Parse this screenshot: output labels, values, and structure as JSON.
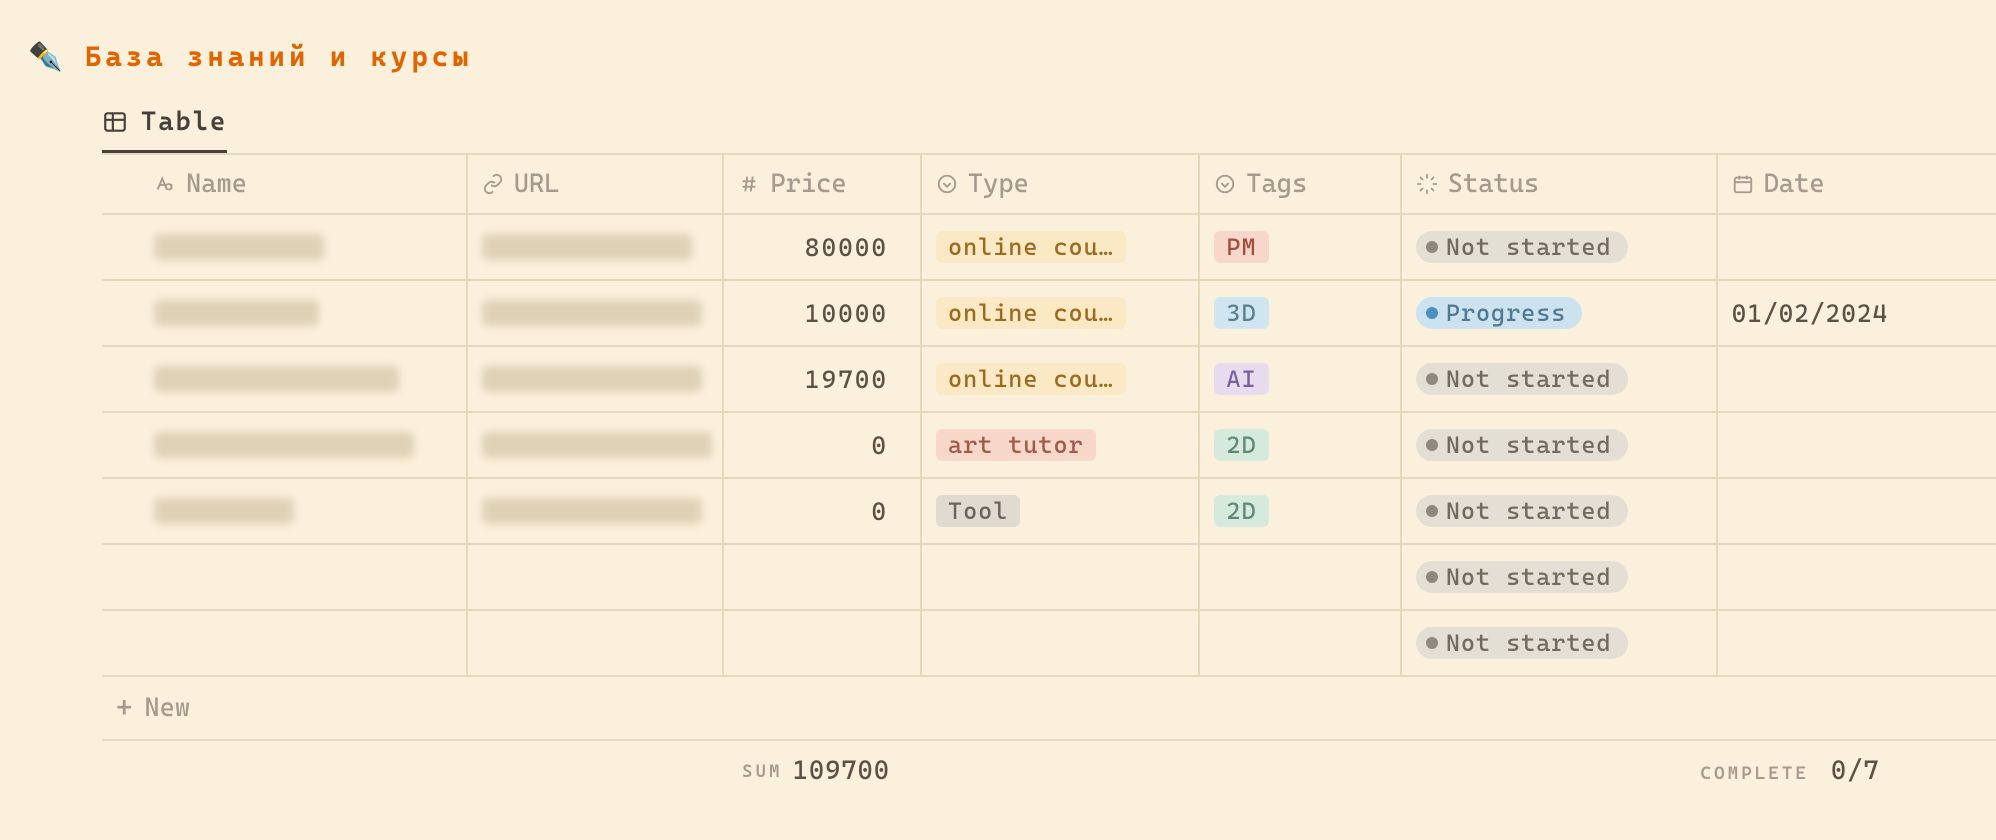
{
  "header": {
    "icon": "✒️",
    "title": "База знаний и курсы"
  },
  "tab": {
    "label": "Table"
  },
  "columns": {
    "name": {
      "label": "Name"
    },
    "url": {
      "label": "URL"
    },
    "price": {
      "label": "Price"
    },
    "type": {
      "label": "Type"
    },
    "tags": {
      "label": "Tags"
    },
    "status": {
      "label": "Status"
    },
    "date": {
      "label": "Date"
    }
  },
  "pill_colors": {
    "online_course": {
      "bg": "#fbe9c6",
      "fg": "#9a6b1f"
    },
    "art_tutor": {
      "bg": "#f6d7ca",
      "fg": "#a05a45"
    },
    "tool": {
      "bg": "#dfdbd1",
      "fg": "#6a645c"
    },
    "PM": {
      "bg": "#f6d7ca",
      "fg": "#a04e3d"
    },
    "3D": {
      "bg": "#cfe5ef",
      "fg": "#5a7f92"
    },
    "AI": {
      "bg": "#e6dced",
      "fg": "#7a5fa0"
    },
    "2D": {
      "bg": "#d6e9dd",
      "fg": "#5f8a72"
    }
  },
  "status_styles": {
    "not_started": {
      "bg": "#e4dfd4",
      "fg": "#726a5e",
      "dot": "#8f887c",
      "label": "Not started"
    },
    "progress": {
      "bg": "#cde2ef",
      "fg": "#4f7a93",
      "dot": "#4a90c2",
      "label": "Progress"
    }
  },
  "rows": [
    {
      "name_blur_w": 170,
      "url_blur_w": 210,
      "price": "80000",
      "type": {
        "text": "online cou…",
        "key": "online_course"
      },
      "tag": {
        "text": "PM",
        "key": "PM"
      },
      "status": "not_started",
      "date": ""
    },
    {
      "name_blur_w": 165,
      "url_blur_w": 220,
      "price": "10000",
      "type": {
        "text": "online cou…",
        "key": "online_course"
      },
      "tag": {
        "text": "3D",
        "key": "3D"
      },
      "status": "progress",
      "date": "01/02/2024"
    },
    {
      "name_blur_w": 245,
      "url_blur_w": 220,
      "price": "19700",
      "type": {
        "text": "online cou…",
        "key": "online_course"
      },
      "tag": {
        "text": "AI",
        "key": "AI"
      },
      "status": "not_started",
      "date": ""
    },
    {
      "name_blur_w": 260,
      "url_blur_w": 230,
      "price": "0",
      "type": {
        "text": "art tutor",
        "key": "art_tutor"
      },
      "tag": {
        "text": "2D",
        "key": "2D"
      },
      "status": "not_started",
      "date": ""
    },
    {
      "name_blur_w": 140,
      "url_blur_w": 220,
      "price": "0",
      "type": {
        "text": "Tool",
        "key": "tool"
      },
      "tag": {
        "text": "2D",
        "key": "2D"
      },
      "status": "not_started",
      "date": ""
    },
    {
      "name_blur_w": 0,
      "url_blur_w": 0,
      "price": "",
      "type": null,
      "tag": null,
      "status": "not_started",
      "date": ""
    },
    {
      "name_blur_w": 0,
      "url_blur_w": 0,
      "price": "",
      "type": null,
      "tag": null,
      "status": "not_started",
      "date": ""
    }
  ],
  "add_row": {
    "label": "New"
  },
  "footer": {
    "price_label": "SUM",
    "price_value": "109700",
    "status_label": "COMPLETE",
    "status_value": "0/7"
  }
}
